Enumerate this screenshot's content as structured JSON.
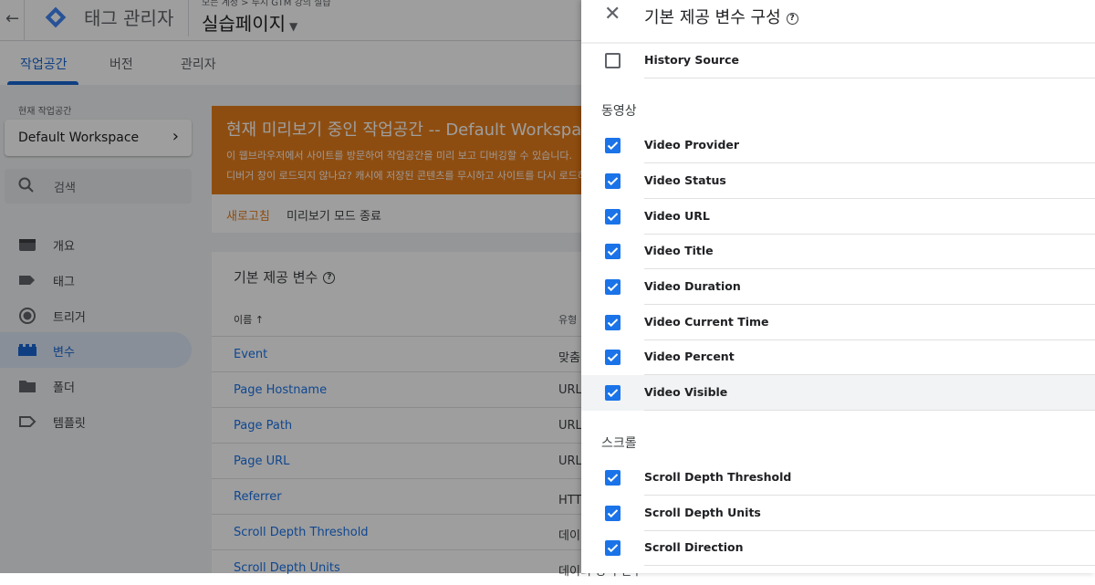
{
  "app": {
    "title": "태그 관리자",
    "breadcrumb": "모든 계정 > 루시 GTM 강의 실습",
    "container": "실습페이지"
  },
  "tabs": [
    {
      "label": "작업공간"
    },
    {
      "label": "버전"
    },
    {
      "label": "관리자"
    }
  ],
  "sidebar": {
    "workspace_label": "현재 작업공간",
    "workspace_name": "Default Workspace",
    "search_placeholder": "검색",
    "items": [
      {
        "label": "개요",
        "icon": "overview-icon"
      },
      {
        "label": "태그",
        "icon": "tag-icon"
      },
      {
        "label": "트리거",
        "icon": "trigger-icon"
      },
      {
        "label": "변수",
        "icon": "variable-icon"
      },
      {
        "label": "폴더",
        "icon": "folder-icon"
      },
      {
        "label": "템플릿",
        "icon": "template-icon"
      }
    ]
  },
  "banner": {
    "title": "현재 미리보기 중인 작업공간 -- Default Workspace",
    "line1": "이 웹브라우저에서 사이트를 방문하여 작업공간을 미리 보고 디버깅할 수 있습니다.",
    "line2": "디버거 창이 로드되지 않나요? 캐시에 저장된 콘텐츠를 무시하고 사이트를 다시 로드하세요.",
    "refresh": "새로고침",
    "exit": "미리보기 모드 종료"
  },
  "card": {
    "title": "기본 제공 변수",
    "col_name": "이름 ↑",
    "col_type": "유형",
    "rows": [
      {
        "name": "Event",
        "type": "맞춤 이벤트"
      },
      {
        "name": "Page Hostname",
        "type": "URL"
      },
      {
        "name": "Page Path",
        "type": "URL"
      },
      {
        "name": "Page URL",
        "type": "URL"
      },
      {
        "name": "Referrer",
        "type": "HTTP 참조자"
      },
      {
        "name": "Scroll Depth Threshold",
        "type": "데이터 영역 변수"
      },
      {
        "name": "Scroll Depth Units",
        "type": "데이터 영역 변수"
      }
    ]
  },
  "panel": {
    "title": "기본 제공 변수 구성",
    "top_items": [
      {
        "label": "History Source",
        "checked": false
      }
    ],
    "sections": [
      {
        "heading": "동영상",
        "items": [
          {
            "label": "Video Provider",
            "checked": true
          },
          {
            "label": "Video Status",
            "checked": true
          },
          {
            "label": "Video URL",
            "checked": true
          },
          {
            "label": "Video Title",
            "checked": true
          },
          {
            "label": "Video Duration",
            "checked": true
          },
          {
            "label": "Video Current Time",
            "checked": true
          },
          {
            "label": "Video Percent",
            "checked": true
          },
          {
            "label": "Video Visible",
            "checked": true
          }
        ]
      },
      {
        "heading": "스크롤",
        "items": [
          {
            "label": "Scroll Depth Threshold",
            "checked": true
          },
          {
            "label": "Scroll Depth Units",
            "checked": true
          },
          {
            "label": "Scroll Direction",
            "checked": true
          }
        ]
      }
    ]
  },
  "colors": {
    "accent": "#1a73e8",
    "banner": "#e67c1b"
  }
}
